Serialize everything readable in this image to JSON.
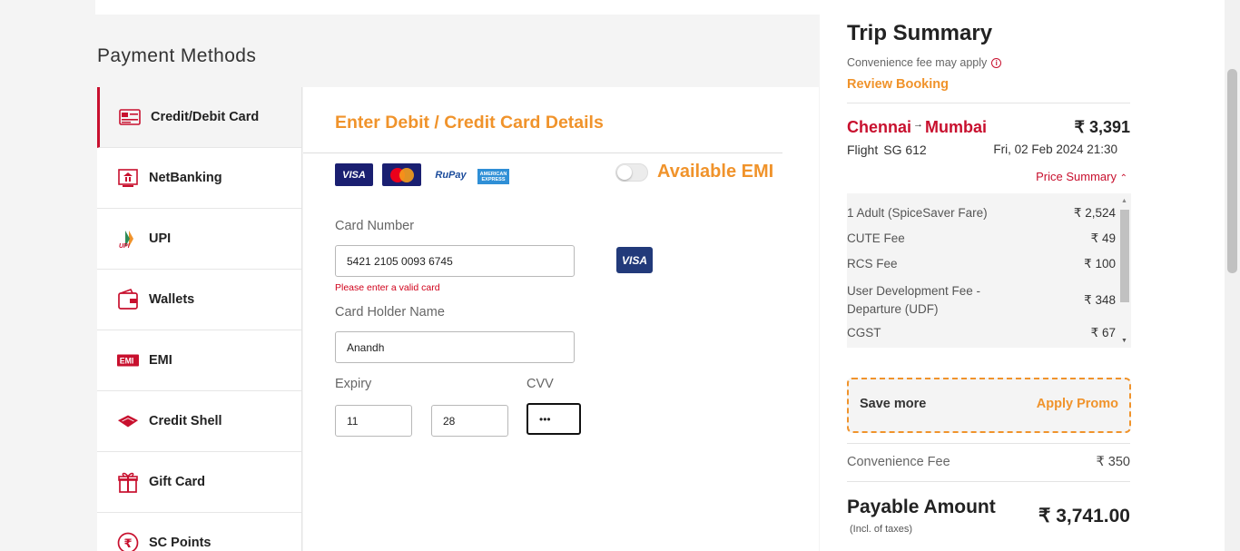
{
  "payment": {
    "title": "Payment Methods",
    "methods": [
      {
        "label": "Credit/Debit Card",
        "icon": "credit-card-icon"
      },
      {
        "label": "NetBanking",
        "icon": "bank-icon"
      },
      {
        "label": "UPI",
        "icon": "upi-icon"
      },
      {
        "label": "Wallets",
        "icon": "wallet-icon"
      },
      {
        "label": "EMI",
        "icon": "emi-icon"
      },
      {
        "label": "Credit Shell",
        "icon": "credit-shell-icon"
      },
      {
        "label": "Gift Card",
        "icon": "gift-icon"
      },
      {
        "label": "SC Points",
        "icon": "rupee-coin-icon"
      }
    ]
  },
  "card_form": {
    "title": "Enter Debit / Credit Card Details",
    "logos": {
      "visa": "VISA",
      "rupay": "RuPay",
      "amex": "AMERICAN EXPRESS"
    },
    "emi_label": "Available EMI",
    "card_number_label": "Card Number",
    "card_number_value": "5421 2105 0093 6745",
    "card_error": "Please enter a valid card",
    "detected_network": "VISA",
    "holder_label": "Card Holder Name",
    "holder_value": "Anandh",
    "expiry_label": "Expiry",
    "expiry_month": "11",
    "expiry_year": "28",
    "cvv_label": "CVV",
    "cvv_value": "•••"
  },
  "summary": {
    "title": "Trip Summary",
    "convenience_note": "Convenience fee may apply",
    "review_link": "Review Booking",
    "origin": "Chennai",
    "destination": "Mumbai",
    "fare": "₹ 3,391",
    "flight_label": "Flight",
    "flight_number": "SG 612",
    "datetime": "Fri, 02 Feb 2024  21:30",
    "price_summary": "Price Summary",
    "fare_rows": [
      {
        "label": "1 Adult  (SpiceSaver Fare)",
        "value": "₹ 2,524"
      },
      {
        "label": "CUTE Fee",
        "value": "₹ 49"
      },
      {
        "label": "RCS Fee",
        "value": "₹ 100"
      },
      {
        "label": "User Development Fee - Departure (UDF)",
        "value": "₹ 348"
      },
      {
        "label": "CGST",
        "value": "₹ 67"
      }
    ],
    "promo_text": "Save more",
    "promo_link": "Apply Promo",
    "convenience_fee_label": "Convenience Fee",
    "convenience_fee_value": "₹ 350",
    "payable_label": "Payable Amount",
    "payable_note": "(Incl. of taxes)",
    "payable_value": "₹ 3,741.00"
  },
  "colors": {
    "brand_red": "#c8102e",
    "accent_orange": "#f0932b"
  }
}
